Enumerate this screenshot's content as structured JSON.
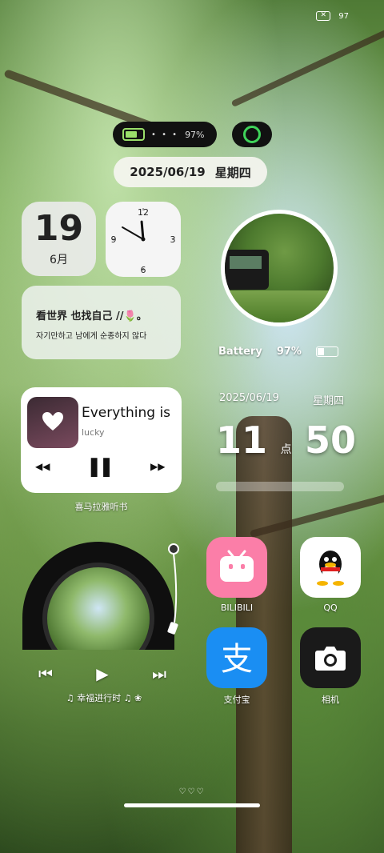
{
  "status_bar": {
    "battery": "97"
  },
  "top_pill": {
    "battery_percent": "97%",
    "dots": "• • •"
  },
  "date_pill": {
    "date": "2025/06/19",
    "weekday": "星期四"
  },
  "day_widget": {
    "day": "19",
    "month": "6月"
  },
  "clock_widget": {
    "numbers": [
      "12",
      "3",
      "6",
      "9"
    ],
    "time": "11:50"
  },
  "quote_widget": {
    "line1": "看世界 也找自己 //🌷。",
    "line2": "자기만하고 남에게 순종하지 않다"
  },
  "battery_widget": {
    "label": "Battery",
    "percent": "97%",
    "level": 0.97
  },
  "right_datetime": {
    "date": "2025/06/19",
    "weekday": "星期四",
    "hour": "11",
    "dian": "点",
    "minute": "50"
  },
  "music_widget": {
    "title": "Everything is",
    "artist": "lucky",
    "source": "喜马拉雅听书",
    "controls": {
      "prev": "◀◀",
      "play_pause": "▌▌",
      "next": "▶▶"
    }
  },
  "vinyl_widget": {
    "song": "♫ 幸福进行时 ♫ ❀",
    "controls": {
      "prev": "⏮",
      "play": "▶",
      "next": "⏭"
    }
  },
  "apps": [
    {
      "label": "BILIBILI",
      "icon": "bilibili-icon"
    },
    {
      "label": "QQ",
      "icon": "qq-icon"
    },
    {
      "label": "支付宝",
      "icon": "alipay-icon"
    },
    {
      "label": "相机",
      "icon": "camera-icon"
    }
  ],
  "page_indicator": "♡♡♡",
  "colors": {
    "battery_green": "#9adf6a",
    "ring_green": "#3fd35a",
    "bilibili_pink": "#fb7ea8",
    "alipay_blue": "#1a8ef3"
  }
}
